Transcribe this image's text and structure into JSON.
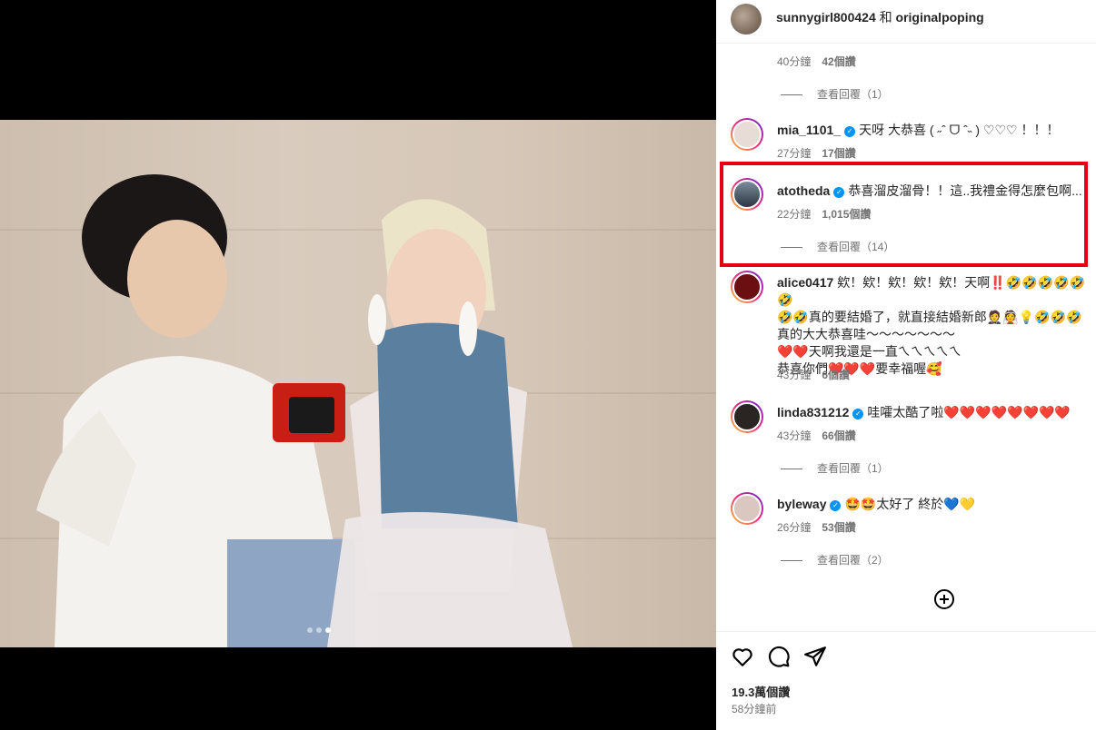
{
  "post": {
    "carousel_dots": 3,
    "active_dot": 2
  },
  "header": {
    "user1": "sunnygirl800424",
    "joiner": "和",
    "user2": "originalpoping"
  },
  "comments": [
    {
      "meta_time": "40分鐘",
      "meta_likes": "42個讚",
      "replies": "查看回覆（1）"
    },
    {
      "user": "mia_1101_",
      "verified": true,
      "text": "天呀 大恭喜 ( ˶ˆ ᗜ ˆ˵ ) ♡♡♡ ！！！",
      "meta_time": "27分鐘",
      "meta_likes": "17個讚"
    },
    {
      "user": "atotheda",
      "verified": true,
      "text": "恭喜溜皮溜骨！！這..我禮金得怎麼包啊...",
      "meta_time": "22分鐘",
      "meta_likes": "1,015個讚",
      "replies": "查看回覆（14）"
    },
    {
      "user": "alice0417",
      "verified": false,
      "text_lines": [
        "欸！欸！欸！欸！欸！天啊‼️🤣🤣🤣🤣🤣🤣",
        "🤣🤣真的要結婚了，就直接結婚新郎🤵👰💡🤣🤣🤣",
        "真的大大恭喜哇～～～～～～～",
        "❤️❤️天啊我還是一直ㄟㄟㄟㄟㄟ",
        "恭喜你們❤️❤️❤️要幸福喔🥰"
      ],
      "meta_time": "43分鐘",
      "meta_likes": "6個讚"
    },
    {
      "user": "linda831212",
      "verified": true,
      "text": "哇嚯太酷了啦❤️❤️❤️❤️❤️❤️❤️❤️",
      "meta_time": "43分鐘",
      "meta_likes": "66個讚",
      "replies": "查看回覆（1）"
    },
    {
      "user": "byleway",
      "verified": true,
      "text": "🤩🤩太好了 終於💙💛",
      "meta_time": "26分鐘",
      "meta_likes": "53個讚",
      "replies": "查看回覆（2）"
    }
  ],
  "footer": {
    "likes": "19.3萬個讚",
    "time": "58分鐘前"
  },
  "icons": {
    "like": "heart-icon",
    "comment": "comment-icon",
    "share": "share-icon",
    "more_comments": "plus-circle-icon"
  },
  "colors": {
    "highlight_border": "#e60012",
    "verified": "#0095f6",
    "meta_text": "#737373"
  }
}
